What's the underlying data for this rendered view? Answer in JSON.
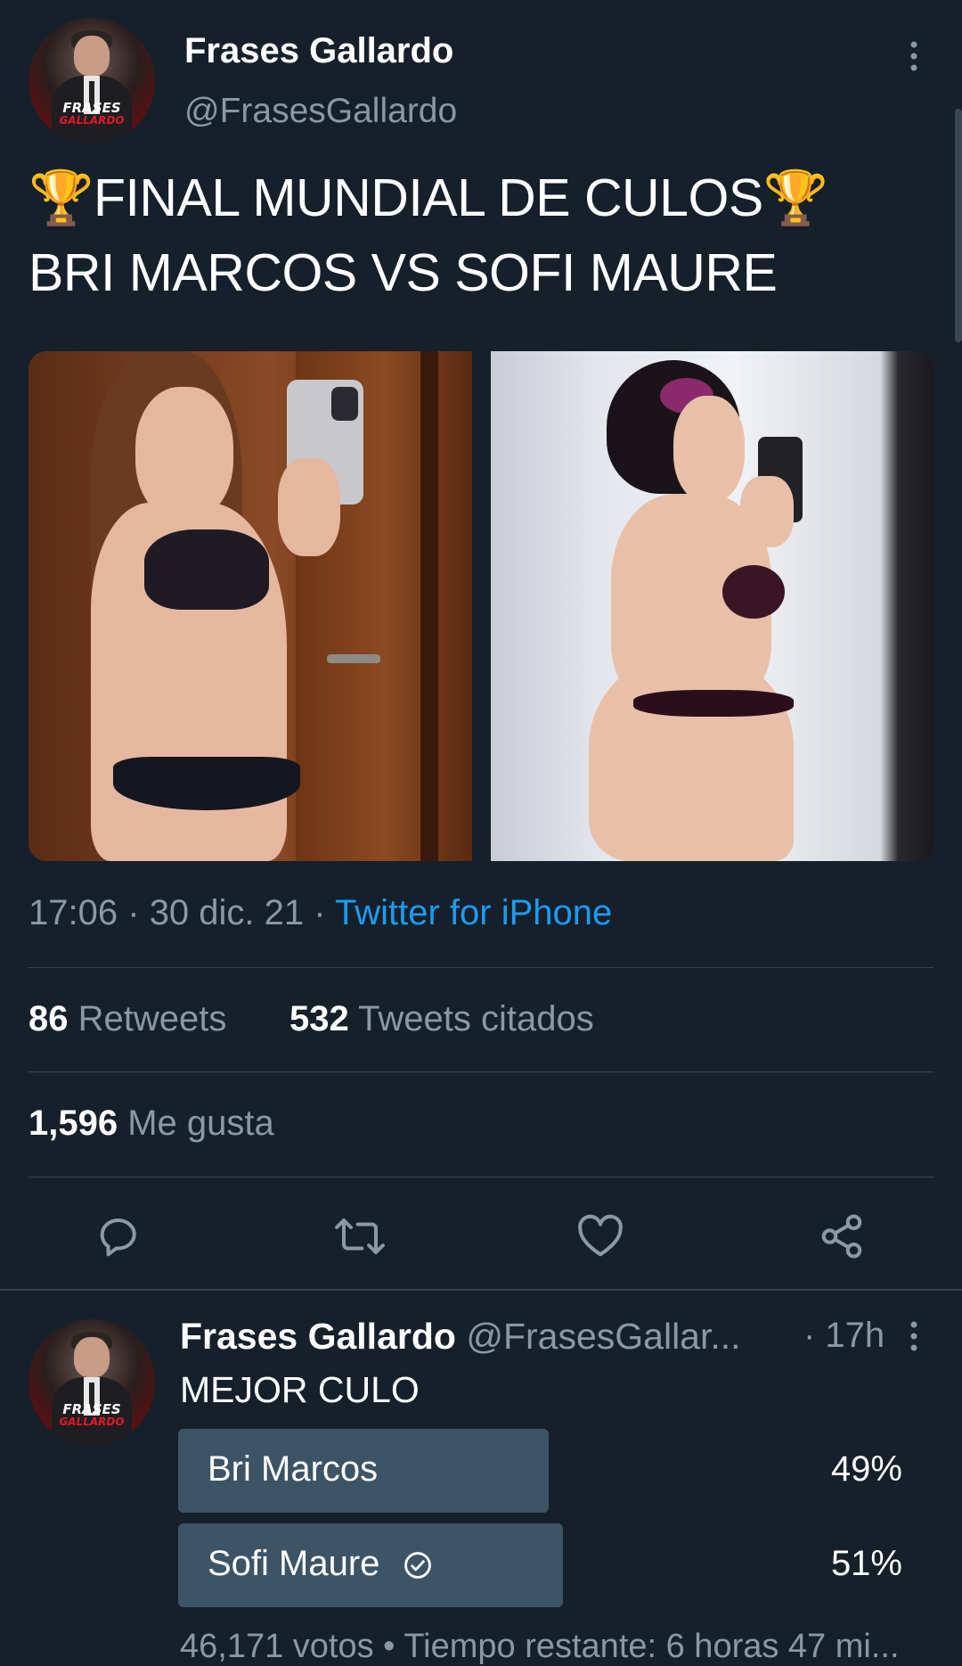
{
  "tweet": {
    "author_name": "Frases Gallardo",
    "author_handle": "@FrasesGallardo",
    "avatar_logo_line1": "FRASES",
    "avatar_logo_line2": "GALLARDO",
    "text_line1": "🏆FINAL MUNDIAL DE CULOS🏆",
    "text_line2": "BRI MARCOS VS SOFI MAURE",
    "time": "17:06",
    "date": "30 dic. 21",
    "separator": "·",
    "source": "Twitter for iPhone",
    "retweets_count": "86",
    "retweets_label": "Retweets",
    "quotes_count": "532",
    "quotes_label": "Tweets citados",
    "likes_count": "1,596",
    "likes_label": "Me gusta"
  },
  "actions": [
    {
      "icon": "reply-icon"
    },
    {
      "icon": "retweet-icon"
    },
    {
      "icon": "like-icon"
    },
    {
      "icon": "share-icon"
    }
  ],
  "reply": {
    "author_name": "Frases Gallardo",
    "author_handle": "@FrasesGallar...",
    "time": "· 17h",
    "text": "MEJOR CULO",
    "avatar_logo_line1": "FRASES",
    "avatar_logo_line2": "GALLARDO",
    "poll": {
      "options": [
        {
          "label": "Bri Marcos",
          "percent_text": "49%",
          "percent": 49,
          "selected": false
        },
        {
          "label": "Sofi Maure",
          "percent_text": "51%",
          "percent": 51,
          "selected": true
        }
      ],
      "footer": "46,171 votos • Tiempo restante: 6 horas 47 mi..."
    }
  },
  "colors": {
    "background": "#15202b",
    "link": "#1d9bf0",
    "muted": "#8b98a5",
    "divider": "#38444d",
    "poll_bar": "#3d5466"
  }
}
